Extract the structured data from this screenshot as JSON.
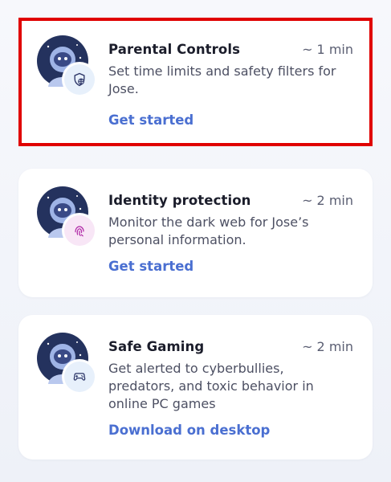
{
  "cards": [
    {
      "title": "Parental Controls",
      "duration": "~ 1 min",
      "description": "Set time limits and safety filters for Jose.",
      "action": "Get started",
      "badge_color": "#e7f0fb",
      "badge_icon": "shield-globe-icon",
      "highlighted": true
    },
    {
      "title": "Identity protection",
      "duration": "~ 2 min",
      "description": "Monitor the dark web for Jose’s personal information.",
      "action": "Get started",
      "badge_color": "#f8e6f6",
      "badge_icon": "fingerprint-icon",
      "highlighted": false
    },
    {
      "title": "Safe Gaming",
      "duration": "~ 2 min",
      "description": "Get alerted to cyberbullies, predators, and toxic behavior in online PC games",
      "action": "Download on desktop",
      "badge_color": "#e7f0fb",
      "badge_icon": "gamepad-shield-icon",
      "highlighted": false
    }
  ],
  "colors": {
    "accent": "#4a6fd1",
    "highlight_border": "#e00000",
    "title": "#1b1d2b",
    "text": "#4d5063"
  }
}
